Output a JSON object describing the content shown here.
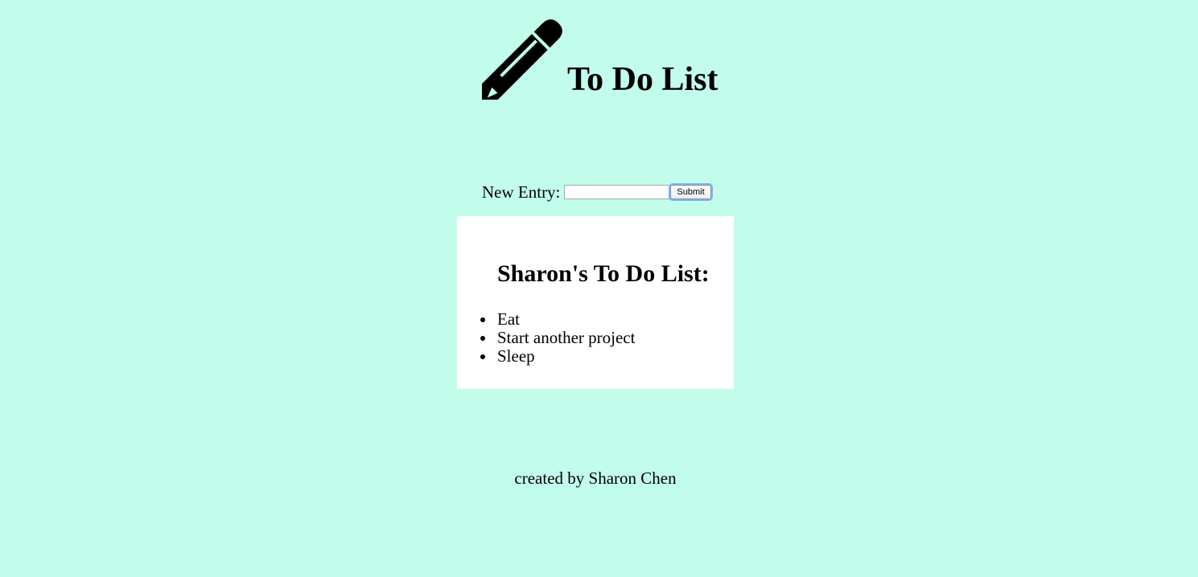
{
  "header": {
    "title": "To Do List",
    "icon": "pencil-icon"
  },
  "entry": {
    "label": "New Entry:",
    "value": "",
    "placeholder": "",
    "submit_label": "Submit"
  },
  "todo": {
    "heading": "Sharon's To Do List:",
    "items": [
      {
        "label": "Eat"
      },
      {
        "label": "Start another project"
      },
      {
        "label": "Sleep"
      }
    ]
  },
  "footer": {
    "credit": "created by Sharon Chen"
  },
  "colors": {
    "background": "#c2fdec",
    "card": "#ffffff",
    "focus_ring": "#79b5f7"
  }
}
